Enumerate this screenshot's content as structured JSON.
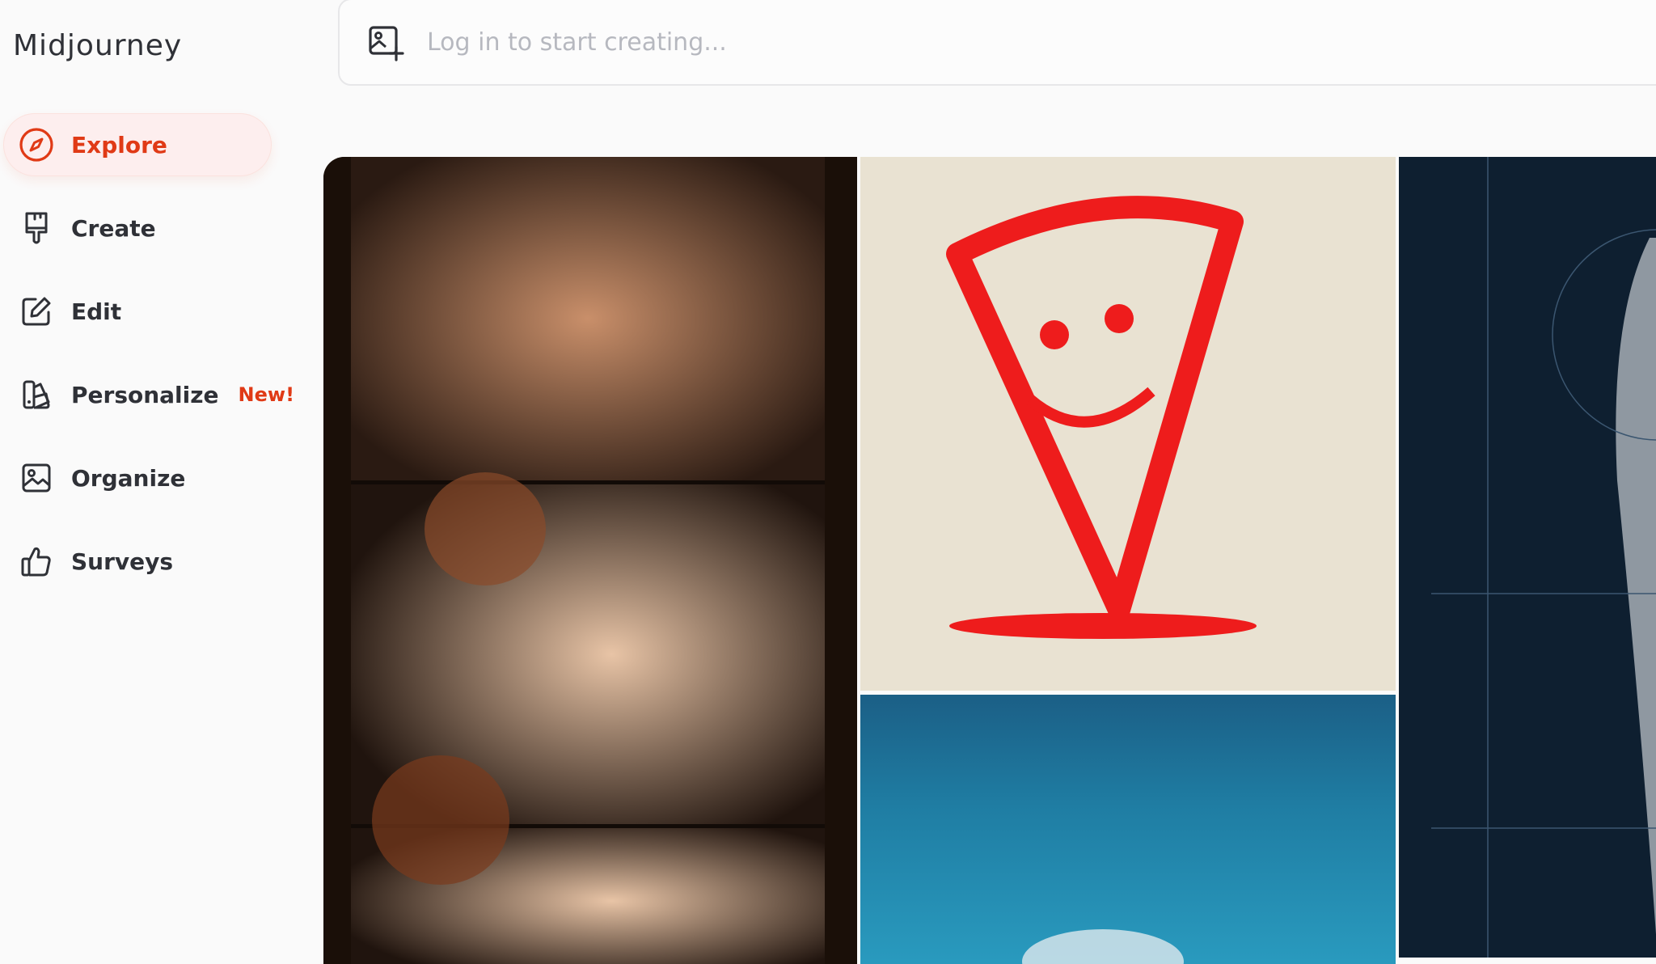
{
  "app": {
    "brand": "Midjourney"
  },
  "nav": {
    "items": [
      {
        "label": "Explore",
        "icon": "compass-icon",
        "active": true
      },
      {
        "label": "Create",
        "icon": "paintbrush-icon"
      },
      {
        "label": "Edit",
        "icon": "edit-icon"
      },
      {
        "label": "Personalize",
        "icon": "palette-icon",
        "badge": "New!"
      },
      {
        "label": "Organize",
        "icon": "image-icon"
      },
      {
        "label": "Surveys",
        "icon": "thumbs-up-icon"
      }
    ]
  },
  "search": {
    "placeholder": "Log in to start creating...",
    "icon": "image-plus-icon"
  },
  "colors": {
    "accent": "#e03a16",
    "accent_bg": "#fdeeee",
    "text": "#2f3137",
    "placeholder": "#b6b8bf"
  },
  "gallery": {
    "tiles": [
      {
        "name": "film-strip-portrait-tile"
      },
      {
        "name": "pizza-character-tile"
      },
      {
        "name": "underwater-ocean-tile"
      },
      {
        "name": "statue-blueprint-tile"
      }
    ]
  }
}
